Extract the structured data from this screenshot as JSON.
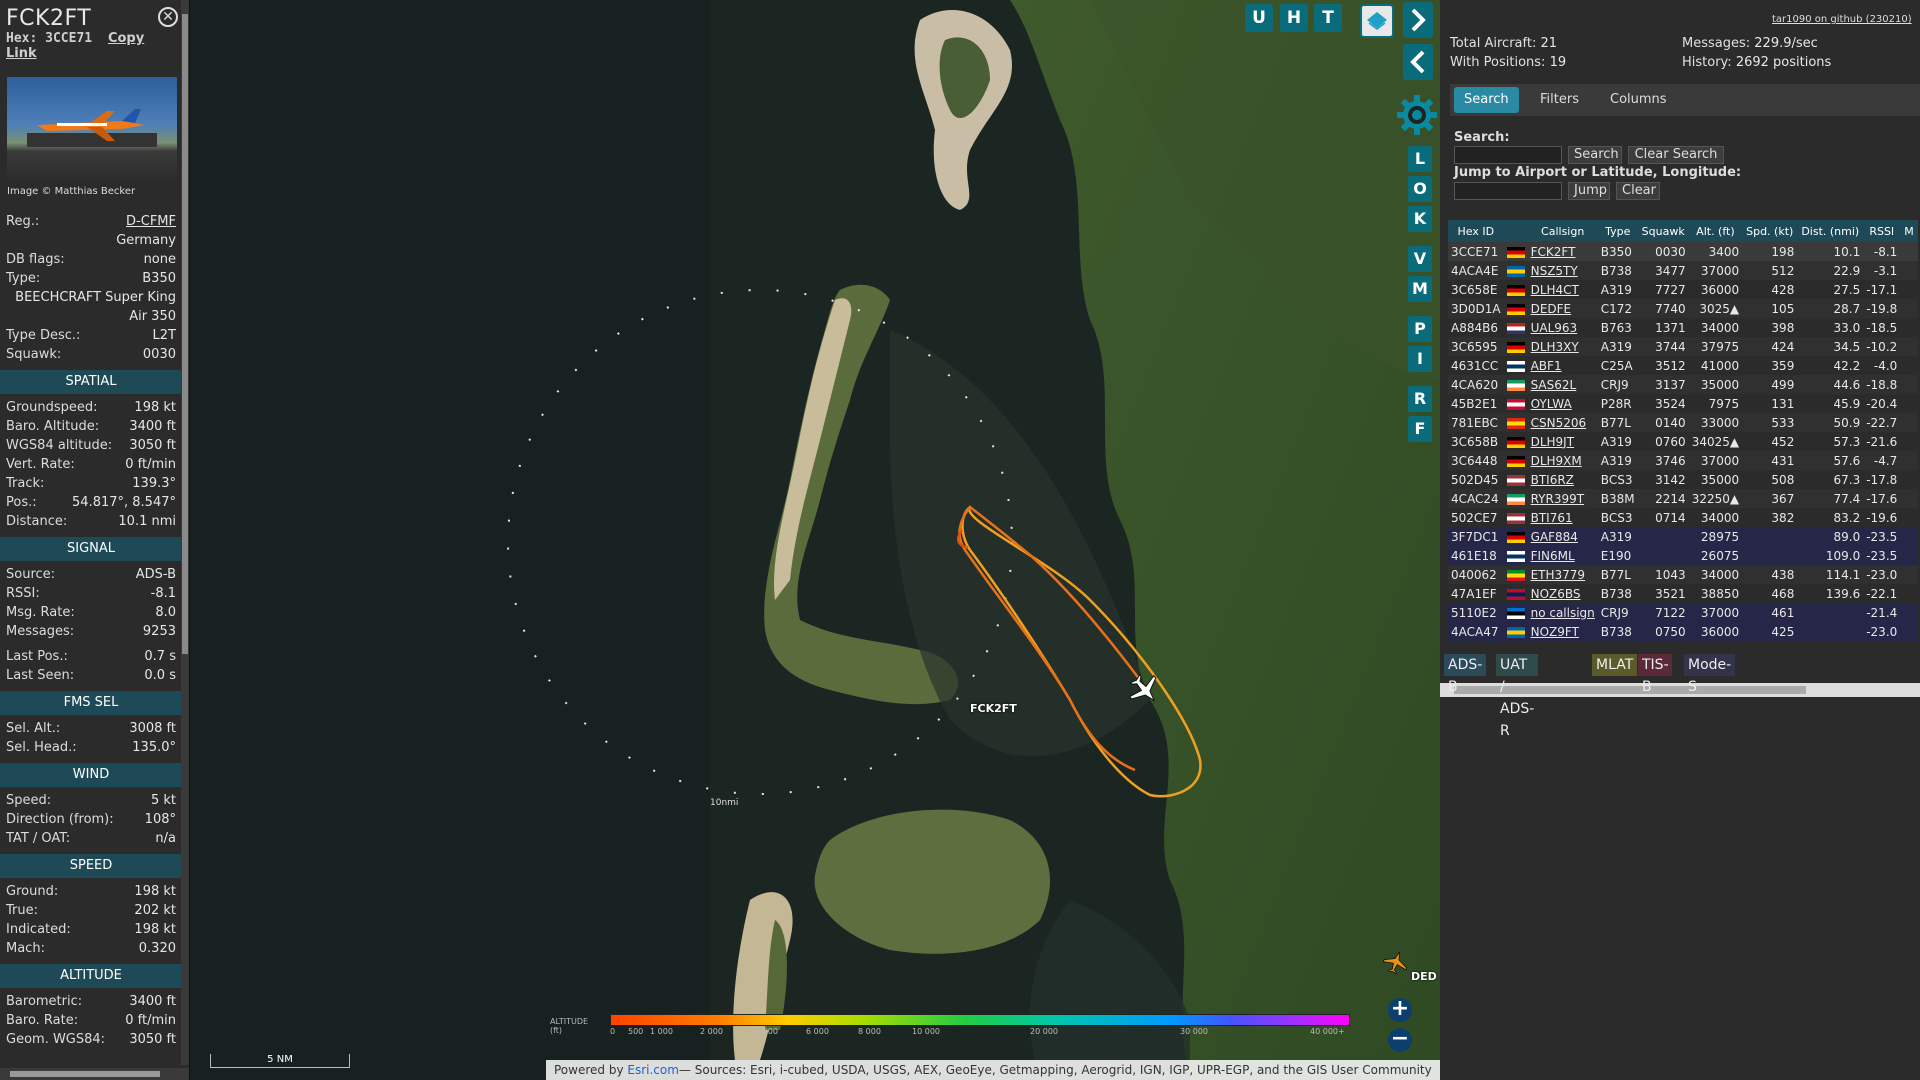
{
  "info": {
    "callsign": "FCK2FT",
    "hex_label": "Hex:",
    "hex": "3CCE71",
    "copy_link": "Copy Link",
    "photo_credit": "Image © Matthias Becker",
    "reg_label": "Reg.:",
    "reg": "D-CFMF",
    "country": "Germany",
    "dbflags_label": "DB flags:",
    "dbflags": "none",
    "type_label": "Type:",
    "type": "B350",
    "type_full": "BEECHCRAFT Super King Air 350",
    "typedesc_label": "Type Desc.:",
    "typedesc": "L2T",
    "squawk_label": "Squawk:",
    "squawk": "0030",
    "sections": {
      "spatial": "SPATIAL",
      "signal": "SIGNAL",
      "fms": "FMS SEL",
      "wind": "WIND",
      "speed": "SPEED",
      "altitude": "ALTITUDE"
    },
    "spatial": {
      "gs_l": "Groundspeed:",
      "gs": "198 kt",
      "baro_l": "Baro. Altitude:",
      "baro": "3400 ft",
      "wgs_l": "WGS84 altitude:",
      "wgs": "3050 ft",
      "vr_l": "Vert. Rate:",
      "vr": "0 ft/min",
      "track_l": "Track:",
      "track": "139.3°",
      "pos_l": "Pos.:",
      "pos": "54.817°, 8.547°",
      "dist_l": "Distance:",
      "dist": "10.1 nmi"
    },
    "signal": {
      "src_l": "Source:",
      "src": "ADS-B",
      "rssi_l": "RSSI:",
      "rssi": "-8.1",
      "mr_l": "Msg. Rate:",
      "mr": "8.0",
      "msgs_l": "Messages:",
      "msgs": "9253",
      "lp_l": "Last Pos.:",
      "lp": "0.7 s",
      "ls_l": "Last Seen:",
      "ls": "0.0 s"
    },
    "fms": {
      "salt_l": "Sel. Alt.:",
      "salt": "3008 ft",
      "shead_l": "Sel. Head.:",
      "shead": "135.0°"
    },
    "wind": {
      "spd_l": "Speed:",
      "spd": "5 kt",
      "dir_l": "Direction (from):",
      "dir": "108°",
      "tat_l": "TAT / OAT:",
      "tat": "n/a"
    },
    "speed": {
      "g_l": "Ground:",
      "g": "198 kt",
      "t_l": "True:",
      "t": "202 kt",
      "i_l": "Indicated:",
      "i": "198 kt",
      "m_l": "Mach:",
      "m": "0.320"
    },
    "altitude": {
      "b_l": "Barometric:",
      "b": "3400 ft",
      "br_l": "Baro. Rate:",
      "br": "0 ft/min",
      "g_l": "Geom. WGS84:",
      "g": "3050 ft"
    }
  },
  "map": {
    "buttons_top": [
      "U",
      "H",
      "T"
    ],
    "side_buttons": [
      "L",
      "O",
      "K",
      "V",
      "M",
      "P",
      "I",
      "R",
      "F"
    ],
    "aircraft_label": "FCK2FT",
    "ring_label": "10nmi",
    "other_label": "DED",
    "alt_legend_label": "ALTITUDE (ft)",
    "alt_ticks": [
      "0",
      "500",
      "1 000",
      "2 000",
      "4 000",
      "6 000",
      "8 000",
      "10 000",
      "20 000",
      "30 000",
      "40 000+"
    ],
    "scale": "5 NM",
    "attribution_prefix": "Powered by ",
    "attribution_link": "Esri.com",
    "attribution_text": "— Sources: Esri, i-cubed, USDA, USGS, AEX, GeoEye, Getmapping, Aerogrid, IGN, IGP, UPR-EGP, and the GIS User Community",
    "zoom_in": "+",
    "zoom_out": "−"
  },
  "side": {
    "github": "tar1090 on github (230210)",
    "total_label": "Total Aircraft:",
    "total": "21",
    "withpos_label": "With Positions:",
    "withpos": "19",
    "messages_label": "Messages:",
    "messages": "229.9/sec",
    "history_label": "History:",
    "history": "2692 positions",
    "tabs": [
      "Search",
      "Filters",
      "Columns"
    ],
    "search_label": "Search:",
    "search_btn": "Search",
    "clear_search_btn": "Clear Search",
    "jump_label": "Jump to Airport or Latitude, Longitude:",
    "jump_btn": "Jump",
    "clear_btn": "Clear",
    "columns": [
      "Hex ID",
      "",
      "Callsign",
      "Type",
      "Squawk",
      "Alt. (ft)",
      "Spd. (kt)",
      "Dist. (nmi)",
      "RSSI",
      "M"
    ],
    "rows": [
      {
        "hex": "3CCE71",
        "flag": "de",
        "cs": "FCK2FT",
        "type": "B350",
        "sq": "0030",
        "alt": "3400",
        "spd": "198",
        "dist": "10.1",
        "rssi": "-8.1",
        "kind": "sel"
      },
      {
        "hex": "4ACA4E",
        "flag": "se",
        "cs": "NSZ5TY",
        "type": "B738",
        "sq": "3477",
        "alt": "37000",
        "spd": "512",
        "dist": "22.9",
        "rssi": "-3.1",
        "kind": "odd"
      },
      {
        "hex": "3C658E",
        "flag": "de",
        "cs": "DLH4CT",
        "type": "A319",
        "sq": "7727",
        "alt": "36000",
        "spd": "428",
        "dist": "27.5",
        "rssi": "-17.1",
        "kind": "even"
      },
      {
        "hex": "3D0D1A",
        "flag": "de",
        "cs": "DEDFE",
        "type": "C172",
        "sq": "7740",
        "alt": "3025▲",
        "spd": "105",
        "dist": "28.7",
        "rssi": "-19.8",
        "kind": "odd"
      },
      {
        "hex": "A884B6",
        "flag": "us",
        "cs": "UAL963",
        "type": "B763",
        "sq": "1371",
        "alt": "34000",
        "spd": "398",
        "dist": "33.0",
        "rssi": "-18.5",
        "kind": "even"
      },
      {
        "hex": "3C6595",
        "flag": "de",
        "cs": "DLH3XY",
        "type": "A319",
        "sq": "3744",
        "alt": "37975",
        "spd": "424",
        "dist": "34.5",
        "rssi": "-10.2",
        "kind": "odd"
      },
      {
        "hex": "4631CC",
        "flag": "fi",
        "cs": "ABF1",
        "type": "C25A",
        "sq": "3512",
        "alt": "41000",
        "spd": "359",
        "dist": "42.2",
        "rssi": "-4.0",
        "kind": "even"
      },
      {
        "hex": "4CA620",
        "flag": "ie",
        "cs": "SAS62L",
        "type": "CRJ9",
        "sq": "3137",
        "alt": "35000",
        "spd": "499",
        "dist": "44.6",
        "rssi": "-18.8",
        "kind": "odd"
      },
      {
        "hex": "45B2E1",
        "flag": "dk",
        "cs": "OYLWA",
        "type": "P28R",
        "sq": "3524",
        "alt": "7975",
        "spd": "131",
        "dist": "45.9",
        "rssi": "-20.4",
        "kind": "even"
      },
      {
        "hex": "781EBC",
        "flag": "cn",
        "cs": "CSN5206",
        "type": "B77L",
        "sq": "0140",
        "alt": "33000",
        "spd": "533",
        "dist": "50.9",
        "rssi": "-22.7",
        "kind": "odd"
      },
      {
        "hex": "3C658B",
        "flag": "de",
        "cs": "DLH9JT",
        "type": "A319",
        "sq": "0760",
        "alt": "34025▲",
        "spd": "452",
        "dist": "57.3",
        "rssi": "-21.6",
        "kind": "even"
      },
      {
        "hex": "3C6448",
        "flag": "de",
        "cs": "DLH9XM",
        "type": "A319",
        "sq": "3746",
        "alt": "37000",
        "spd": "431",
        "dist": "57.6",
        "rssi": "-4.7",
        "kind": "odd"
      },
      {
        "hex": "502D45",
        "flag": "lv",
        "cs": "BTI6RZ",
        "type": "BCS3",
        "sq": "3142",
        "alt": "35000",
        "spd": "508",
        "dist": "67.3",
        "rssi": "-17.8",
        "kind": "even"
      },
      {
        "hex": "4CAC24",
        "flag": "ie",
        "cs": "RYR399T",
        "type": "B38M",
        "sq": "2214",
        "alt": "32250▲",
        "spd": "367",
        "dist": "77.4",
        "rssi": "-17.6",
        "kind": "odd"
      },
      {
        "hex": "502CE7",
        "flag": "lv",
        "cs": "BTI761",
        "type": "BCS3",
        "sq": "0714",
        "alt": "34000",
        "spd": "382",
        "dist": "83.2",
        "rssi": "-19.6",
        "kind": "even"
      },
      {
        "hex": "3F7DC1",
        "flag": "de",
        "cs": "GAF884",
        "type": "A319",
        "sq": "",
        "alt": "28975",
        "spd": "",
        "dist": "89.0",
        "rssi": "-23.5",
        "kind": "mlat"
      },
      {
        "hex": "461E18",
        "flag": "fi",
        "cs": "FIN6ML",
        "type": "E190",
        "sq": "",
        "alt": "26075",
        "spd": "",
        "dist": "109.0",
        "rssi": "-23.5",
        "kind": "mlat"
      },
      {
        "hex": "040062",
        "flag": "et",
        "cs": "ETH3779",
        "type": "B77L",
        "sq": "1043",
        "alt": "34000",
        "spd": "438",
        "dist": "114.1",
        "rssi": "-23.0",
        "kind": "odd"
      },
      {
        "hex": "47A1EF",
        "flag": "no",
        "cs": "NOZ6BS",
        "type": "B738",
        "sq": "3521",
        "alt": "38850",
        "spd": "468",
        "dist": "139.6",
        "rssi": "-22.1",
        "kind": "even"
      },
      {
        "hex": "5110E2",
        "flag": "ee",
        "cs": "no callsign",
        "type": "CRJ9",
        "sq": "7122",
        "alt": "37000",
        "spd": "461",
        "dist": "",
        "rssi": "-21.4",
        "kind": "mlat"
      },
      {
        "hex": "4ACA47",
        "flag": "se",
        "cs": "NOZ9FT",
        "type": "B738",
        "sq": "0750",
        "alt": "36000",
        "spd": "425",
        "dist": "",
        "rssi": "-23.0",
        "kind": "mlat"
      }
    ],
    "legend": [
      {
        "label": "ADS-B",
        "bg": "#2b4a5a"
      },
      {
        "label": "UAT / ADS-R",
        "bg": "#2f4a4a"
      },
      {
        "label": "MLAT",
        "bg": "#5a5a2a"
      },
      {
        "label": "TIS-B",
        "bg": "#5a2a3a"
      },
      {
        "label": "Mode-S",
        "bg": "#33334a"
      }
    ]
  }
}
